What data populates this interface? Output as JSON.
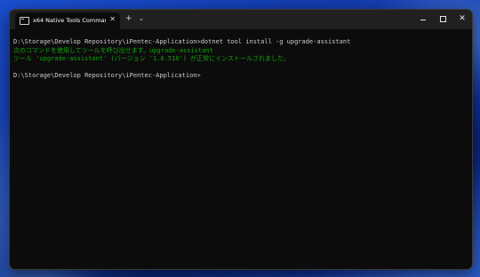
{
  "tab": {
    "title": "x64 Native Tools Command Pr",
    "close_glyph": "✕",
    "new_tab_glyph": "+",
    "dropdown_glyph": "⌄"
  },
  "window_controls": {
    "close_glyph": "✕"
  },
  "terminal": {
    "lines": [
      {
        "text": "D:\\Storage\\Develop Repository\\iPentec-Application>dotnet tool install -g upgrade-assistant",
        "color": "#cccccc"
      },
      {
        "text": "次のコマンドを使用してツールを呼び出せます。upgrade-assistant",
        "color": "#13a10e"
      },
      {
        "text": "ツール 'upgrade-assistant' (バージョン '1.0.518') が正常にインストールされました。",
        "color": "#13a10e"
      },
      {
        "text": "",
        "color": "#cccccc"
      },
      {
        "text": "D:\\Storage\\Develop Repository\\iPentec-Application>",
        "color": "#cccccc"
      }
    ]
  }
}
